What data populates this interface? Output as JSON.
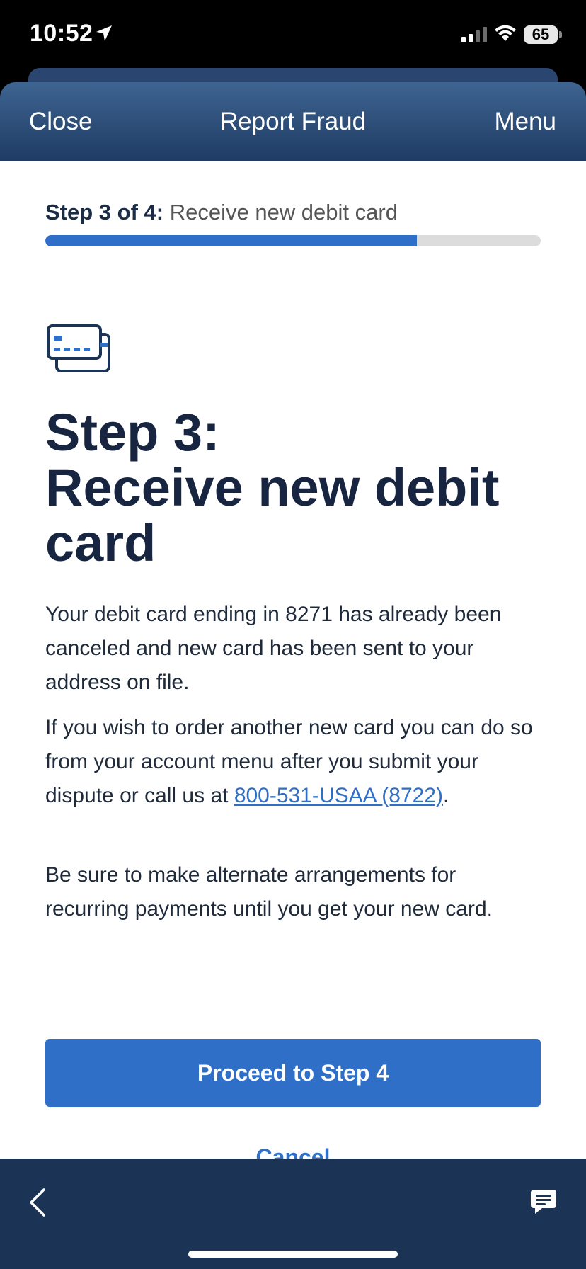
{
  "status_bar": {
    "time": "10:52",
    "battery": "65"
  },
  "nav": {
    "close_label": "Close",
    "title": "Report Fraud",
    "menu_label": "Menu"
  },
  "progress": {
    "step_count": "Step 3 of 4:",
    "step_name": "Receive new debit card",
    "percent": 75
  },
  "main": {
    "heading_line1": "Step 3:",
    "heading_line2": "Receive new debit card",
    "para1": "Your debit card ending in 8271 has already been canceled and new card has been sent to your address on file.",
    "para2_text": "If you wish to order another new card you can do so from your account menu after you submit your dispute or call us at ",
    "phone_link": "800-531-USAA (8722)",
    "para2_end": ".",
    "para3": "Be sure to make alternate arrangements for recurring payments until you get your new card."
  },
  "actions": {
    "proceed_label": "Proceed to Step 4",
    "cancel_label": "Cancel"
  },
  "icons": {
    "card": "credit-card-icon",
    "back": "chevron-left-icon",
    "chat": "chat-icon"
  },
  "colors": {
    "brand_blue": "#2f6fc8",
    "header_dark": "#1e3b63",
    "bottom_bar": "#1b3354",
    "heading_text": "#172540"
  }
}
